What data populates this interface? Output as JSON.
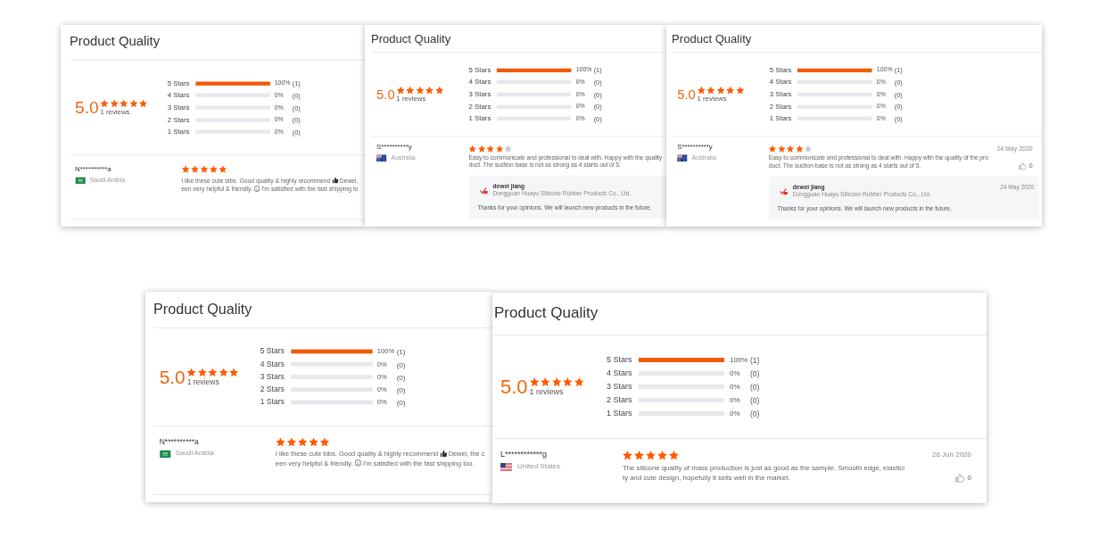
{
  "cards": [
    {
      "title": "Product Quality",
      "summary": {
        "score": "5.0",
        "stars": 5,
        "reviews": "1 reviews",
        "distribution": [
          {
            "label": "5 Stars",
            "level": 1,
            "percent": "100%",
            "count": "(1)"
          },
          {
            "label": "4 Stars",
            "level": 0,
            "percent": "0%",
            "count": "(0)"
          },
          {
            "label": "3 Stars",
            "level": 0,
            "percent": "0%",
            "count": "(0)"
          },
          {
            "label": "2 Stars",
            "level": 0,
            "percent": "0%",
            "count": "(0)"
          },
          {
            "label": "1 Stars",
            "level": 0,
            "percent": "0%",
            "count": "(0)"
          }
        ]
      },
      "review": {
        "user": "N**********a",
        "country": {
          "name": "Saudi Arabia",
          "kind": "saudi"
        },
        "stars": 5,
        "lines": [
          [
            {
              "kind": "text",
              "text": "I like these cute bibs. Good quality & highly recommend"
            },
            {
              "kind": "thumbsup"
            },
            {
              "kind": "text",
              "text": "Dewei,"
            }
          ],
          [
            {
              "kind": "text",
              "text": "een very helpful & friendly."
            },
            {
              "kind": "smiley"
            },
            {
              "kind": "text",
              "text": "I'm satisfied with the fast shipping to"
            }
          ]
        ]
      }
    },
    {
      "title": "Product Quality",
      "summary": {
        "score": "5.0",
        "stars": 5,
        "reviews": "1 reviews",
        "distribution": [
          {
            "label": "5 Stars",
            "level": 1,
            "percent": "100%",
            "count": "(1)"
          },
          {
            "label": "4 Stars",
            "level": 0,
            "percent": "0%",
            "count": "(0)"
          },
          {
            "label": "3 Stars",
            "level": 0,
            "percent": "0%",
            "count": "(0)"
          },
          {
            "label": "2 Stars",
            "level": 0,
            "percent": "0%",
            "count": "(0)"
          },
          {
            "label": "1 Stars",
            "level": 0,
            "percent": "0%",
            "count": "(0)"
          }
        ]
      },
      "review": {
        "user": "S**********y",
        "country": {
          "name": "Australia",
          "kind": "australia"
        },
        "stars": 4,
        "lines": [
          [
            {
              "kind": "text",
              "text": "Easy to communicate and professional to deal with. Happy with the quality"
            }
          ],
          [
            {
              "kind": "text",
              "text": "duct. The suction base is not as strong as 4 starts out of 5."
            }
          ]
        ],
        "reply": {
          "name": "dewei jiang",
          "company": "Dongguan Huayu Silicone Rubber Products Co., Ltd.",
          "text": "Thanks for your opinions. We will launch new products in the future,"
        }
      }
    },
    {
      "title": "Product Quality",
      "summary": {
        "score": "5.0",
        "stars": 5,
        "reviews": "1 reviews",
        "distribution": [
          {
            "label": "5 Stars",
            "level": 1,
            "percent": "100%",
            "count": "(1)"
          },
          {
            "label": "4 Stars",
            "level": 0,
            "percent": "0%",
            "count": "(0)"
          },
          {
            "label": "3 Stars",
            "level": 0,
            "percent": "0%",
            "count": "(0)"
          },
          {
            "label": "2 Stars",
            "level": 0,
            "percent": "0%",
            "count": "(0)"
          },
          {
            "label": "1 Stars",
            "level": 0,
            "percent": "0%",
            "count": "(0)"
          }
        ]
      },
      "review": {
        "user": "S**********y",
        "country": {
          "name": "Australia",
          "kind": "australia"
        },
        "stars": 4,
        "date": "24 May 2020",
        "likes": "0",
        "lines": [
          [
            {
              "kind": "text",
              "text": "Easy to communicate and professional to deal with. Happy with the quality of the pro"
            }
          ],
          [
            {
              "kind": "text",
              "text": "duct. The suction base is not as strong as 4 starts out of 5."
            }
          ]
        ],
        "reply": {
          "name": "dewei jiang",
          "company": "Dongguan Huayu Silicone Rubber Products Co., Ltd.",
          "date": "24 May 2020",
          "text": "Thanks for your opinions. We will launch new products in the future,"
        }
      }
    },
    {
      "title": "Product Quality",
      "summary": {
        "score": "5.0",
        "stars": 5,
        "reviews": "1 reviews",
        "distribution": [
          {
            "label": "5 Stars",
            "level": 1,
            "percent": "100%",
            "count": "(1)"
          },
          {
            "label": "4 Stars",
            "level": 0,
            "percent": "0%",
            "count": "(0)"
          },
          {
            "label": "3 Stars",
            "level": 0,
            "percent": "0%",
            "count": "(0)"
          },
          {
            "label": "2 Stars",
            "level": 0,
            "percent": "0%",
            "count": "(0)"
          },
          {
            "label": "1 Stars",
            "level": 0,
            "percent": "0%",
            "count": "(0)"
          }
        ]
      },
      "review": {
        "user": "N**********a",
        "country": {
          "name": "Saudi Arabia",
          "kind": "saudi"
        },
        "stars": 5,
        "lines": [
          [
            {
              "kind": "text",
              "text": "I like these cute bibs. Good quality & highly recommend"
            },
            {
              "kind": "thumbsup"
            },
            {
              "kind": "text",
              "text": "Dewei, the c"
            }
          ],
          [
            {
              "kind": "text",
              "text": "een very helpful & friendly."
            },
            {
              "kind": "smiley"
            },
            {
              "kind": "text",
              "text": "I'm satisfied with the fast shipping too."
            }
          ]
        ]
      }
    },
    {
      "title": "Product Quality",
      "summary": {
        "score": "5.0",
        "stars": 5,
        "reviews": "1 reviews",
        "distribution": [
          {
            "label": "5 Stars",
            "level": 1,
            "percent": "100%",
            "count": "(1)"
          },
          {
            "label": "4 Stars",
            "level": 0,
            "percent": "0%",
            "count": "(0)"
          },
          {
            "label": "3 Stars",
            "level": 0,
            "percent": "0%",
            "count": "(0)"
          },
          {
            "label": "2 Stars",
            "level": 0,
            "percent": "0%",
            "count": "(0)"
          },
          {
            "label": "1 Stars",
            "level": 0,
            "percent": "0%",
            "count": "(0)"
          }
        ]
      },
      "review": {
        "user": "L************g",
        "country": {
          "name": "United States",
          "kind": "usa"
        },
        "stars": 5,
        "date": "26 Jun 2020",
        "likes": "0",
        "lines": [
          [
            {
              "kind": "text",
              "text": "The silicone quality of mass production is just as good as the sample. Smooth edge, elastici"
            }
          ],
          [
            {
              "kind": "text",
              "text": "ty and cute design, hopefully it sells well in the market."
            }
          ]
        ]
      }
    }
  ]
}
